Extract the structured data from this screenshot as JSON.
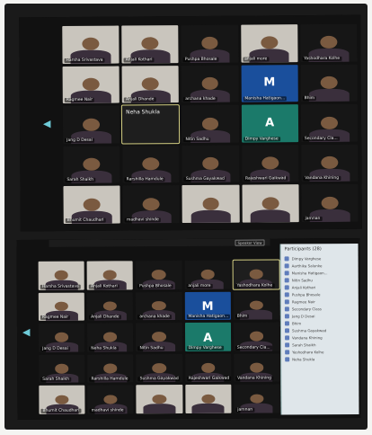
{
  "top_photo": {
    "tiles": [
      {
        "label": "Harsha Srivastava",
        "tone": "light"
      },
      {
        "label": "Anjali Kothari",
        "tone": "light"
      },
      {
        "label": "Pushpa Bhosale",
        "tone": "dark"
      },
      {
        "label": "anjali more",
        "tone": "light"
      },
      {
        "label": "Yashodhara Kolhe",
        "tone": "dark"
      },
      {
        "label": "Ragmee Nair",
        "tone": "light"
      },
      {
        "label": "Anjali Dhande",
        "tone": "light"
      },
      {
        "label": "archana khade",
        "tone": "dark"
      },
      {
        "label": "Manisha Hatigaon...",
        "tone": "blue",
        "letter": "M"
      },
      {
        "label": "Bhim",
        "tone": "dark"
      },
      {
        "label": "Jang D Desai",
        "tone": "dark"
      },
      {
        "label": "",
        "tone": "featured",
        "feature": "Neha Shukla"
      },
      {
        "label": "Nitin Sadhu",
        "tone": "dark"
      },
      {
        "label": "Dimpy Varghese",
        "tone": "teal",
        "letter": "A"
      },
      {
        "label": "Secondary Cla...",
        "tone": "dark"
      },
      {
        "label": "Sarah Shaikh",
        "tone": "dark"
      },
      {
        "label": "Rarshilla Hamdule",
        "tone": "dark"
      },
      {
        "label": "Sushma Gayakwad",
        "tone": "dark"
      },
      {
        "label": "Rajeshwari Gaikwad",
        "tone": "dark"
      },
      {
        "label": "Vandana Khining",
        "tone": "dark"
      },
      {
        "label": "Bhumit Chaudhari",
        "tone": "light"
      },
      {
        "label": "madhavi shinde",
        "tone": "dark"
      },
      {
        "label": "",
        "tone": "light"
      },
      {
        "label": "",
        "tone": "light"
      },
      {
        "label": "jamnan",
        "tone": "dark"
      }
    ]
  },
  "bottom_photo": {
    "tiles": [
      {
        "label": "Harsha Srivastava",
        "tone": "light"
      },
      {
        "label": "Anjali Kothari",
        "tone": "light"
      },
      {
        "label": "Pushpa Bhosale",
        "tone": "dark"
      },
      {
        "label": "anjali more",
        "tone": "dark"
      },
      {
        "label": "Yashodhara Kolhe",
        "tone": "featured"
      },
      {
        "label": "Ragmee Nair",
        "tone": "light"
      },
      {
        "label": "Anjali Dhande",
        "tone": "dark"
      },
      {
        "label": "archana khade",
        "tone": "dark"
      },
      {
        "label": "Manisha Hatigaon...",
        "tone": "blue",
        "letter": "M"
      },
      {
        "label": "Bhim",
        "tone": "dark"
      },
      {
        "label": "Jang D Desai",
        "tone": "dark"
      },
      {
        "label": "Neha Shukla",
        "tone": "dark"
      },
      {
        "label": "Nitin Sadhu",
        "tone": "dark"
      },
      {
        "label": "Dimpy Varghese",
        "tone": "teal",
        "letter": "A"
      },
      {
        "label": "Secondary Cla...",
        "tone": "dark"
      },
      {
        "label": "Sarah Shaikh",
        "tone": "dark"
      },
      {
        "label": "Rarshilla Hamdule",
        "tone": "dark"
      },
      {
        "label": "Sushma Gayakwad",
        "tone": "dark"
      },
      {
        "label": "Rajeshwari Gaikwad",
        "tone": "dark"
      },
      {
        "label": "Vandana Khining",
        "tone": "dark"
      },
      {
        "label": "Bhumit Chaudhari",
        "tone": "light"
      },
      {
        "label": "madhavi shinde",
        "tone": "dark"
      },
      {
        "label": "",
        "tone": "light"
      },
      {
        "label": "",
        "tone": "light"
      },
      {
        "label": "jamnan",
        "tone": "dark"
      }
    ],
    "panel_title": "Participants (28)",
    "panel_rows": [
      "Dimpy Varghese",
      "Aarthika Salunke",
      "Manisha Hatigaon...",
      "Nitin Sadhu",
      "Anjali Kothari",
      "Pushpa Bhosale",
      "Ragmee Nair",
      "Secondary Class",
      "Jang D Desai",
      "Bhim",
      "Sushma Gayakwad",
      "Vandana Khining",
      "Sarah Shaikh",
      "Yashodhara Kolhe",
      "Neha Shukla"
    ],
    "strip_button": "Speaker View"
  }
}
